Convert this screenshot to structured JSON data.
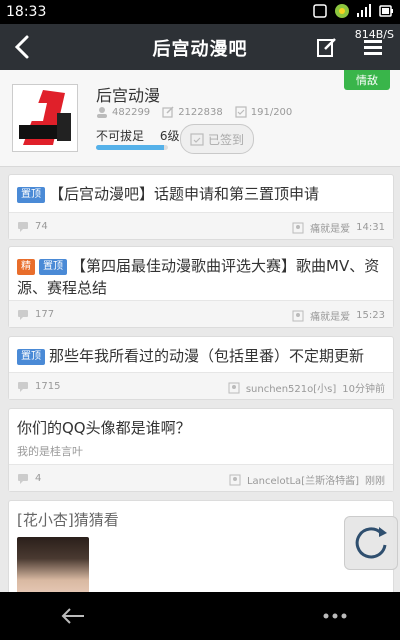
{
  "status": {
    "time": "18:33",
    "net_speed": "814B/S"
  },
  "header": {
    "title": "后宫动漫吧"
  },
  "forum": {
    "name": "后宫动漫",
    "stats": [
      "482299",
      "2122838",
      "191/200"
    ],
    "level_label": "不可拔足",
    "level": "6级",
    "progress": 0.95,
    "sign_label": "已签到",
    "badge": "情敌"
  },
  "posts": [
    {
      "tags": [
        "置顶"
      ],
      "title": "【后宫动漫吧】话题申请和第三置顶申请",
      "replies": "74",
      "author": "痛就是爱",
      "time": "14:31"
    },
    {
      "tags": [
        "精",
        "置顶"
      ],
      "title": "【第四届最佳动漫歌曲评选大赛】歌曲MV、资源、赛程总结",
      "replies": "177",
      "author": "痛就是爱",
      "time": "15:23"
    },
    {
      "tags": [
        "置顶"
      ],
      "title": "那些年我所看过的动漫（包括里番）不定期更新",
      "replies": "1715",
      "author": "sunchen521o[小s]",
      "time": "10分钟前"
    },
    {
      "tags": [],
      "title": "你们的QQ头像都是谁啊？",
      "subtitle": "我的是桂言叶",
      "replies": "4",
      "author": "LancelotLa[兰斯洛特酱]",
      "time": "刚刚"
    },
    {
      "tags": [],
      "title": "[花小杏]猜猜看"
    }
  ],
  "colors": {
    "header": "#2d3136",
    "accent_blue": "#4a8ad6",
    "accent_orange": "#e86d2b",
    "badge_green": "#39b54a"
  }
}
